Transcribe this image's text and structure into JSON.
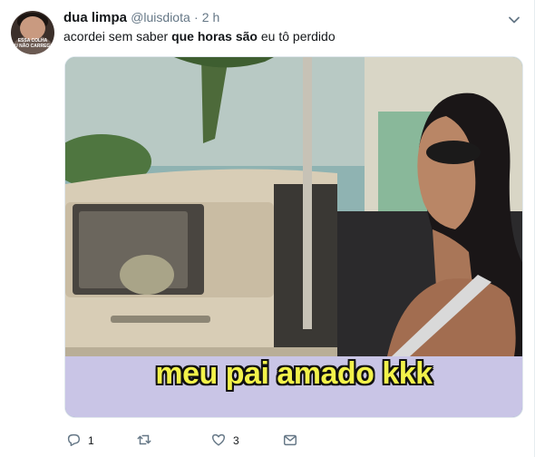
{
  "tweet": {
    "name": "dua limpa",
    "handle": "@luisdiota",
    "separator": "·",
    "time": "2 h",
    "avatar_caption": "ESSA COLHA\nEU NÃO CARREGO",
    "text_before": "acordei sem saber ",
    "text_bold": "que horas são",
    "text_after": " eu tô perdido",
    "media_caption": "meu pai amado kkk",
    "actions": {
      "reply_count": "1",
      "retweet_count": "",
      "like_count": "3"
    },
    "icons": {
      "menu": "chevron-down-icon",
      "reply": "reply-icon",
      "retweet": "retweet-icon",
      "like": "heart-icon",
      "dm": "envelope-icon"
    },
    "colors": {
      "text": "#14171a",
      "secondary": "#657786",
      "caption": "#f2f24a"
    }
  }
}
